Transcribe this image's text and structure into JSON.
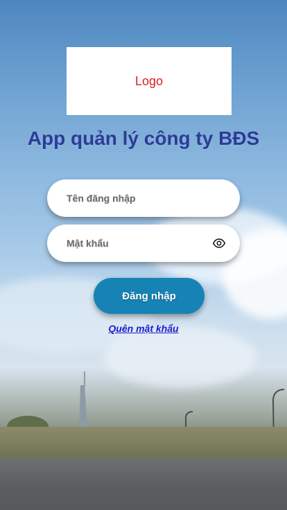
{
  "logo": {
    "text": "Logo"
  },
  "app": {
    "title": "App quản lý công ty BĐS"
  },
  "form": {
    "username_placeholder": "Tên đăng nhập",
    "username_value": "",
    "password_placeholder": "Mật khẩu",
    "password_value": "",
    "login_label": "Đăng nhập",
    "forgot_label": "Quên mật khẩu"
  },
  "icons": {
    "password_toggle": "eye-icon"
  },
  "colors": {
    "title": "#2d3b96",
    "button": "#1783b5",
    "link": "#1a1acc",
    "logo_text": "#d6201f"
  }
}
